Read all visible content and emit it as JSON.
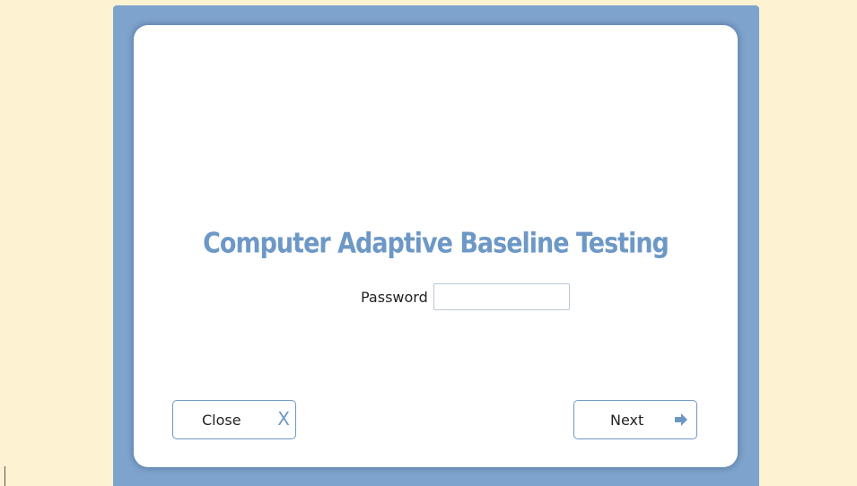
{
  "app": {
    "title": "Computer Adaptive  Baseline Testing"
  },
  "form": {
    "password_label": "Password",
    "password_value": "",
    "password_placeholder": ""
  },
  "buttons": {
    "close_label": "Close",
    "close_icon_glyph": "X",
    "next_label": "Next"
  },
  "icons": {
    "close": "close-x-icon",
    "next": "arrow-right-icon"
  },
  "colors": {
    "background": "#fdf3d2",
    "frame": "#7ea4cd",
    "accent": "#6d98c6"
  }
}
